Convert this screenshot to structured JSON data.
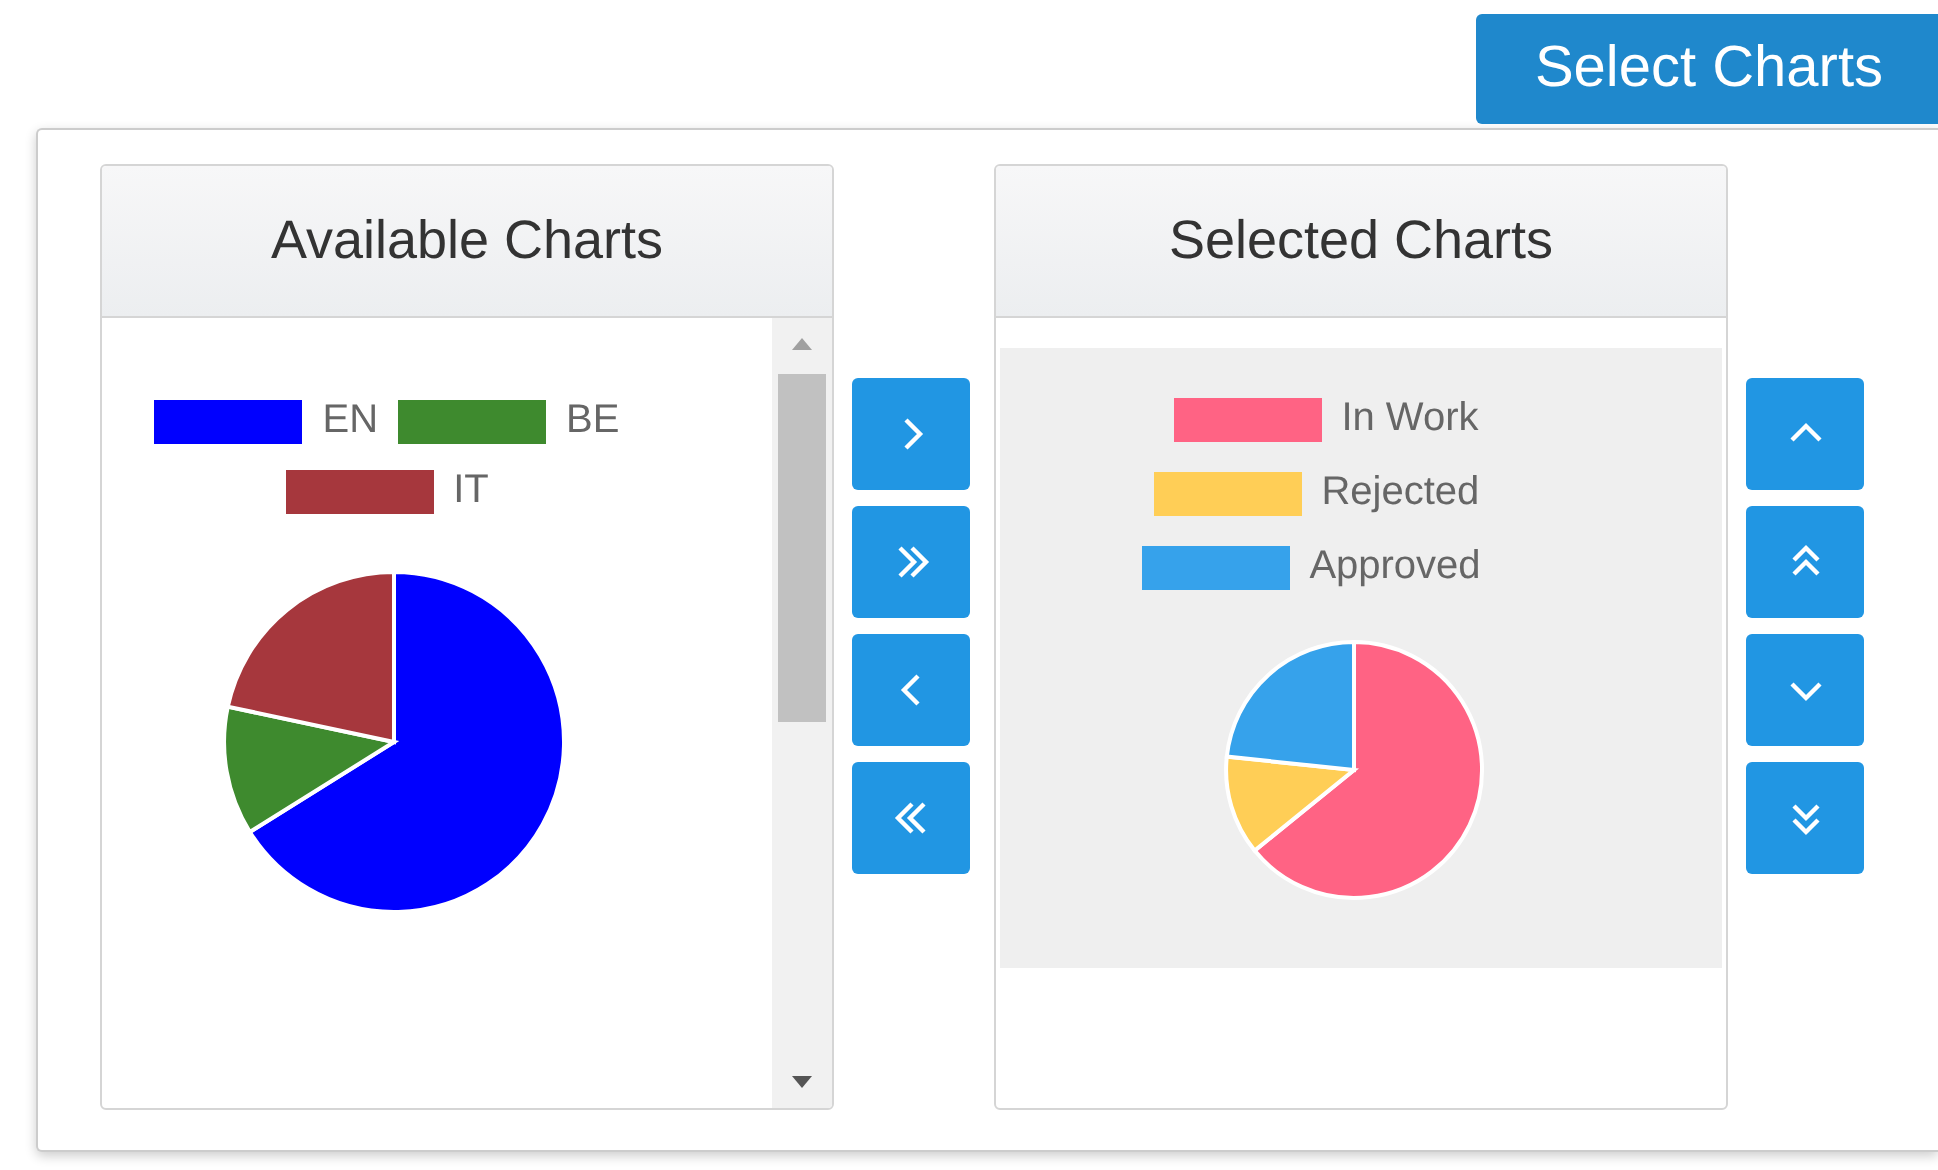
{
  "select_button": "Select Charts",
  "available": {
    "title": "Available Charts",
    "legend": [
      {
        "label": "EN",
        "color": "#0000ff"
      },
      {
        "label": "BE",
        "color": "#3e8a2e"
      },
      {
        "label": "IT",
        "color": "#a6373d"
      }
    ]
  },
  "transfer_buttons": [
    {
      "kind": "right"
    },
    {
      "kind": "all-right"
    },
    {
      "kind": "left"
    },
    {
      "kind": "all-left"
    }
  ],
  "selected": {
    "title": "Selected Charts",
    "legend": [
      {
        "label": "In Work",
        "color": "#ff6384"
      },
      {
        "label": "Rejected",
        "color": "#ffce56"
      },
      {
        "label": "Approved",
        "color": "#36a2eb"
      }
    ]
  },
  "order_buttons": [
    {
      "kind": "up"
    },
    {
      "kind": "top"
    },
    {
      "kind": "down"
    },
    {
      "kind": "bottom"
    }
  ]
}
